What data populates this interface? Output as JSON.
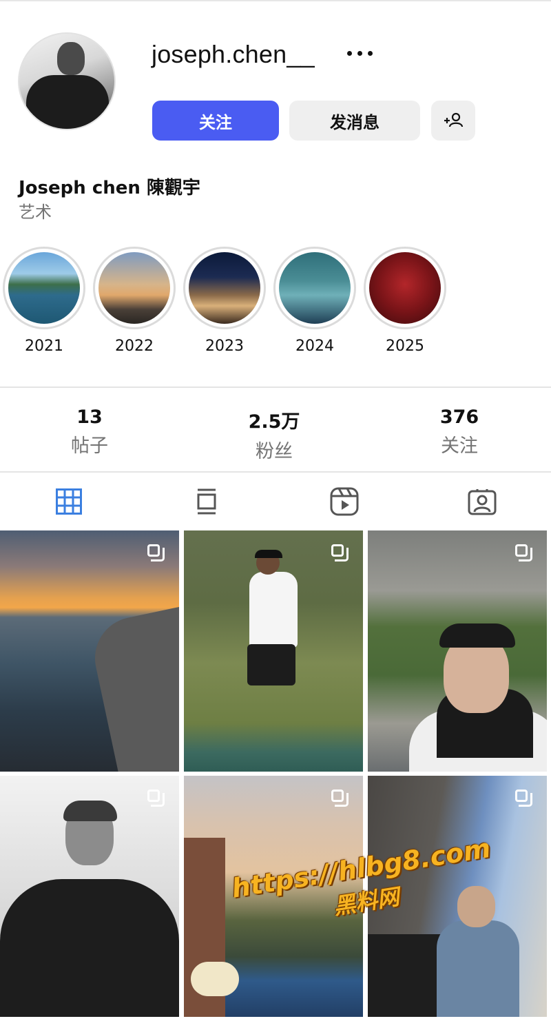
{
  "profile": {
    "username": "joseph.chen__",
    "full_name": "Joseph chen 陳觀宇",
    "category": "艺术"
  },
  "actions": {
    "follow_label": "关注",
    "message_label": "发消息",
    "add_user_icon": "add-person-icon"
  },
  "highlights": [
    {
      "label": "2021"
    },
    {
      "label": "2022"
    },
    {
      "label": "2023"
    },
    {
      "label": "2024"
    },
    {
      "label": "2025"
    }
  ],
  "stats": [
    {
      "value": "13",
      "label": "帖子"
    },
    {
      "value": "2.5万",
      "label": "粉丝"
    },
    {
      "value": "376",
      "label": "关注"
    }
  ],
  "tabs": [
    {
      "icon": "grid-icon",
      "active": true
    },
    {
      "icon": "feed-icon",
      "active": false
    },
    {
      "icon": "reels-icon",
      "active": false
    },
    {
      "icon": "tagged-icon",
      "active": false
    }
  ],
  "colors": {
    "accent": "#4a5cf2",
    "active_tab": "#3b7fe0",
    "secondary_text": "#737373"
  },
  "posts": [
    {
      "description_icon": "multi-photo-icon"
    },
    {
      "description_icon": "multi-photo-icon"
    },
    {
      "description_icon": "multi-photo-icon"
    },
    {
      "description_icon": "multi-photo-icon"
    },
    {
      "description_icon": "multi-photo-icon"
    },
    {
      "description_icon": "multi-photo-icon"
    }
  ],
  "watermark": {
    "url": "https://hlbg8.com",
    "name": "黑料网"
  }
}
